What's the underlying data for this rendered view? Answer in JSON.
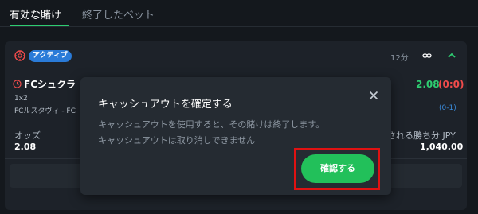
{
  "tabs": {
    "active_label": "有効な賭け",
    "inactive_label": "終了したベット"
  },
  "card": {
    "status_badge": "アクティブ",
    "time": "12分",
    "bet_title": "FCシュクラ",
    "odds_top": "2.08",
    "score_top": "(0:0)",
    "market": "1x2",
    "match": "FCルスタヴィ - FC",
    "score_bottom": "(0-1)",
    "odds_label": "オッズ",
    "odds_value": "2.08",
    "win_label": "される勝ち分 JPY",
    "win_value": "1,040.00"
  },
  "modal": {
    "title": "キャッシュアウトを確定する",
    "desc_line1": "キャッシュアウトを使用すると、その賭けは終了します。",
    "desc_line2": "キャッシュアウトは取り消しできません",
    "confirm_label": "確認する"
  },
  "colors": {
    "accent_green": "#2ecc71",
    "badge_blue": "#2a7bd8",
    "score_red": "#ef4b4b",
    "highlight_red": "#e01212"
  },
  "icons": [
    "sticky-note-icon",
    "link-icon",
    "chevron-up-icon",
    "clock-icon",
    "close-icon"
  ]
}
